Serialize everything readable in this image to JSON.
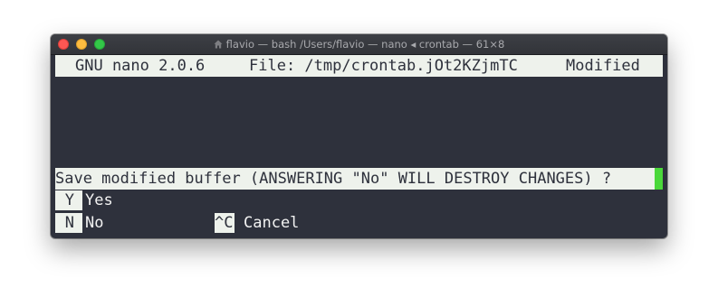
{
  "window": {
    "title": "flavio — bash /Users/flavio — nano ◂ crontab — 61×8"
  },
  "header": {
    "app": "GNU nano 2.0.6",
    "file": "File: /tmp/crontab.jOt2KZjmTC",
    "status": "Modified"
  },
  "prompt": {
    "text": "Save modified buffer (ANSWERING \"No\" WILL DESTROY CHANGES) ?"
  },
  "shortcuts": [
    {
      "key": "Y",
      "label": "Yes"
    },
    {
      "key": "N",
      "label": "No"
    },
    {
      "key": "^C",
      "label": "Cancel"
    }
  ],
  "colors": {
    "terminal_bg": "#2e313c",
    "bar_bg": "#eef2ec",
    "cursor": "#4ad83a"
  },
  "icons": {
    "title_icon": "home-icon"
  }
}
